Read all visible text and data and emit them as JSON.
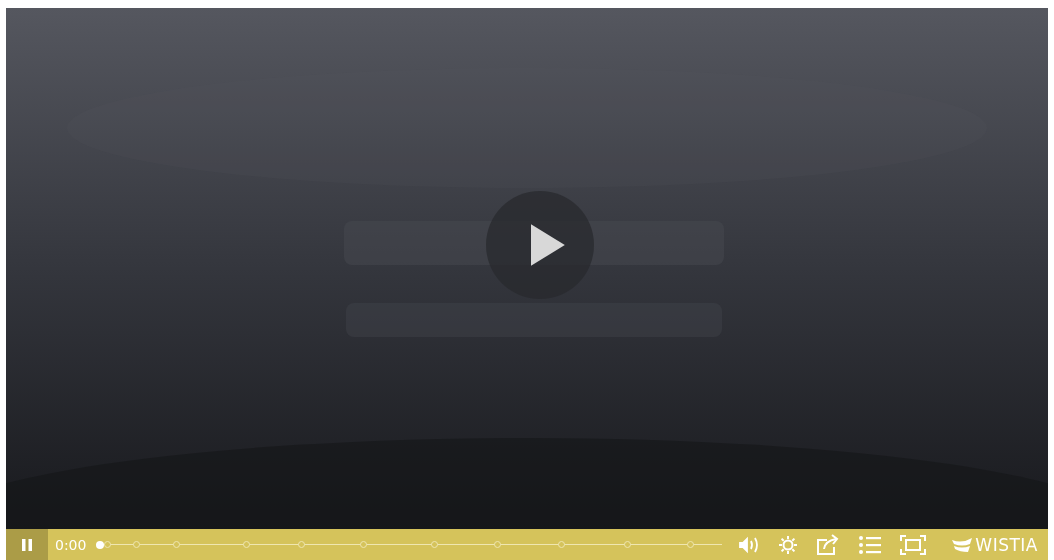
{
  "play_overlay": {
    "shown": true
  },
  "controls": {
    "playing": true,
    "time": "0:00",
    "progress": {
      "level": 0
    },
    "buttons": [
      {
        "kind": "volume"
      },
      {
        "kind": "settings"
      },
      {
        "kind": "share"
      },
      {
        "kind": "chapters"
      },
      {
        "kind": "fullscreen"
      }
    ]
  },
  "brand": {
    "name": "WISTIA"
  }
}
